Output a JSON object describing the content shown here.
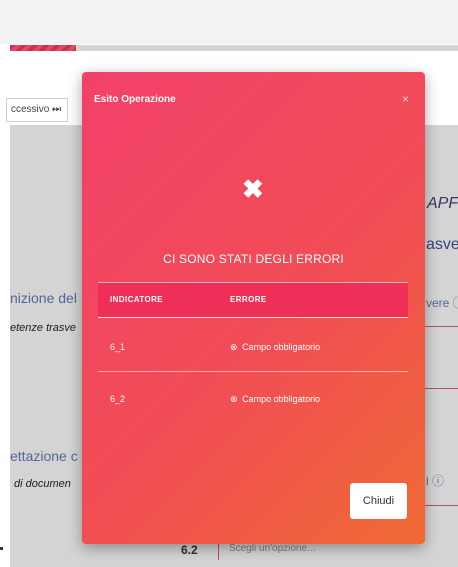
{
  "background": {
    "next_button_label": "ccessivo ⏭",
    "left_heading_1": "nizione del",
    "left_italic_1": "etenze trasve",
    "left_heading_2": "ettazione c",
    "left_italic_2": "di documen",
    "right_italic": "APF",
    "right_blue": "asve",
    "right_link_1": "vere ⓘ",
    "right_link_2": "i ⓘ",
    "row_number": "6.2",
    "select_placeholder": "Scegli un'opzione..."
  },
  "modal": {
    "title": "Esito Operazione",
    "close_icon": "×",
    "status_icon": "✖",
    "message": "CI SONO STATI DEGLI ERRORI",
    "columns": [
      "INDICATORE",
      "ERRORE"
    ],
    "rows": [
      {
        "indicator": "6_1",
        "error_icon": "⊗",
        "error": "Campo obbligatorio"
      },
      {
        "indicator": "6_2",
        "error_icon": "⊗",
        "error": "Campo obbligatorio"
      }
    ],
    "close_button_label": "Chiudi"
  },
  "colors": {
    "modal_gradient_start": "#f3406a",
    "modal_gradient_end": "#f06a34",
    "header_row": "#ef2f58",
    "accent_blue": "#5b6fa6"
  }
}
